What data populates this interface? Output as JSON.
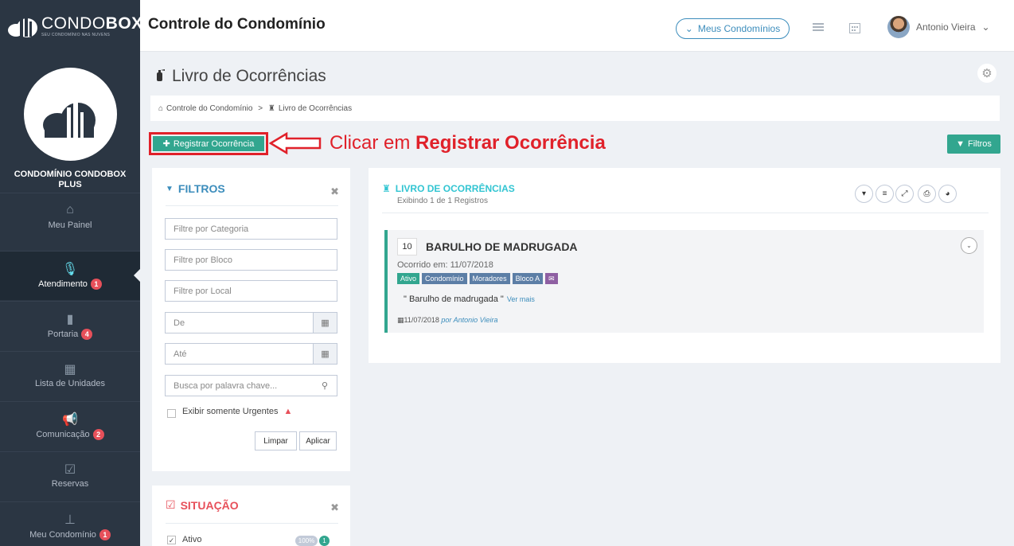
{
  "brand": {
    "name_light": "CONDO",
    "name_bold": "BOX",
    "tagline": "SEU CONDOMÍNIO NAS NUVENS"
  },
  "header": {
    "title": "Controle do Condomínio",
    "condos_button": "Meus Condomínios",
    "user_name": "Antonio Vieira"
  },
  "sidebar": {
    "condo_name_line1": "CONDOMÍNIO CONDOBOX",
    "condo_name_line2": "PLUS",
    "items": [
      {
        "label": "Meu Painel",
        "icon": "home-icon",
        "badge": ""
      },
      {
        "label": "Atendimento",
        "icon": "microphone-icon",
        "badge": "1"
      },
      {
        "label": "Portaria",
        "icon": "door-icon",
        "badge": "4"
      },
      {
        "label": "Lista de Unidades",
        "icon": "building-icon",
        "badge": ""
      },
      {
        "label": "Comunicação",
        "icon": "megaphone-icon",
        "badge": "2"
      },
      {
        "label": "Reservas",
        "icon": "calendar-check-icon",
        "badge": ""
      },
      {
        "label": "Meu Condomínio",
        "icon": "pin-icon",
        "badge": "1"
      }
    ]
  },
  "page": {
    "title": "Livro de Ocorrências",
    "breadcrumb": [
      "Controle do Condomínio",
      "Livro de Ocorrências"
    ],
    "register_button": "Registrar Ocorrência",
    "filters_button": "Filtros"
  },
  "annotation": {
    "prefix": "Clicar em ",
    "bold": "Registrar Ocorrência",
    "color": "#e0212a"
  },
  "filters": {
    "title": "FILTROS",
    "fields": [
      {
        "placeholder": "Filtre por Categoria"
      },
      {
        "placeholder": "Filtre por Bloco"
      },
      {
        "placeholder": "Filtre por Local"
      },
      {
        "placeholder": "De"
      },
      {
        "placeholder": "Até"
      },
      {
        "placeholder": "Busca por palavra chave..."
      }
    ],
    "urgent_label": "Exibir somente Urgentes",
    "clear_button": "Limpar",
    "apply_button": "Aplicar"
  },
  "situacao": {
    "title": "SITUAÇÃO",
    "items": [
      {
        "label": "Ativo",
        "percent": "100%",
        "count": "1",
        "checked": true
      }
    ]
  },
  "book": {
    "title": "LIVRO DE OCORRÊNCIAS",
    "subtitle": "Exibindo 1 de 1 Registros",
    "occurrences": [
      {
        "number": "10",
        "title": "BARULHO DE MADRUGADA",
        "occurred": "Ocorrido em: 11/07/2018",
        "tags": [
          {
            "label": "Ativo",
            "color": "#32a68f"
          },
          {
            "label": "Condomínio",
            "color": "#5c7ea6"
          },
          {
            "label": "Moradores",
            "color": "#5c7ea6"
          },
          {
            "label": "Bloco A",
            "color": "#5c7ea6"
          },
          {
            "label": "✉",
            "color": "#8e5fa2"
          }
        ],
        "text": "\" Barulho de madrugada \"",
        "more": "Ver mais",
        "date": "11/07/2018",
        "author": "por Antonio Vieira"
      }
    ]
  },
  "colors": {
    "accent": "#32a68f",
    "cyan": "#32c5d2",
    "sidebar": "#2b3643",
    "danger": "#e7505a",
    "situacao": "#e7505a"
  }
}
